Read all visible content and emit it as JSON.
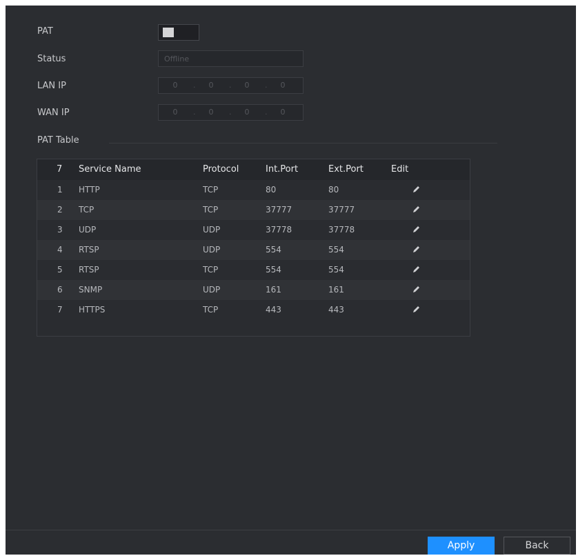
{
  "form": {
    "pat_label": "PAT",
    "status_label": "Status",
    "status_value": "Offline",
    "lan_ip_label": "LAN IP",
    "lan_ip": [
      "0",
      "0",
      "0",
      "0"
    ],
    "wan_ip_label": "WAN IP",
    "wan_ip": [
      "0",
      "0",
      "0",
      "0"
    ]
  },
  "pat_table": {
    "title": "PAT Table",
    "headers": {
      "count": "7",
      "service_name": "Service Name",
      "protocol": "Protocol",
      "int_port": "Int.Port",
      "ext_port": "Ext.Port",
      "edit": "Edit"
    },
    "rows": [
      {
        "no": "1",
        "service": "HTTP",
        "protocol": "TCP",
        "int_port": "80",
        "ext_port": "80"
      },
      {
        "no": "2",
        "service": "TCP",
        "protocol": "TCP",
        "int_port": "37777",
        "ext_port": "37777"
      },
      {
        "no": "3",
        "service": "UDP",
        "protocol": "UDP",
        "int_port": "37778",
        "ext_port": "37778"
      },
      {
        "no": "4",
        "service": "RTSP",
        "protocol": "UDP",
        "int_port": "554",
        "ext_port": "554"
      },
      {
        "no": "5",
        "service": "RTSP",
        "protocol": "TCP",
        "int_port": "554",
        "ext_port": "554"
      },
      {
        "no": "6",
        "service": "SNMP",
        "protocol": "UDP",
        "int_port": "161",
        "ext_port": "161"
      },
      {
        "no": "7",
        "service": "HTTPS",
        "protocol": "TCP",
        "int_port": "443",
        "ext_port": "443"
      }
    ],
    "edit_icon": "pencil-icon"
  },
  "footer": {
    "apply_label": "Apply",
    "back_label": "Back"
  },
  "colors": {
    "background": "#2b2d31",
    "accent": "#1e90ff"
  }
}
